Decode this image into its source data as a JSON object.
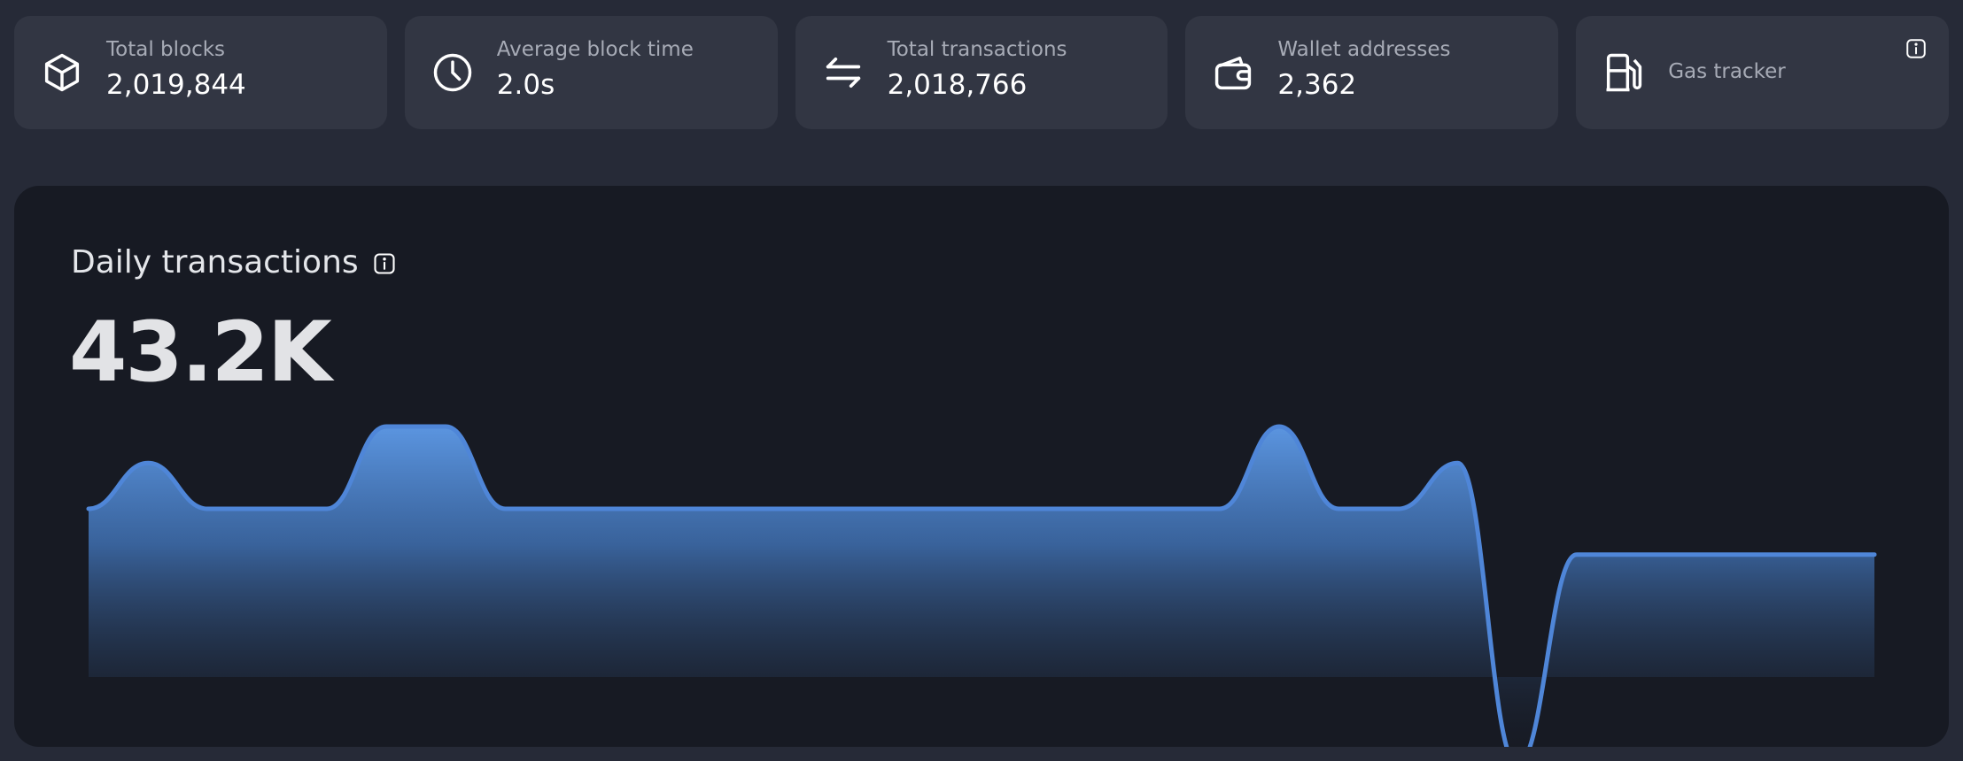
{
  "stats": {
    "total_blocks": {
      "label": "Total blocks",
      "value": "2,019,844",
      "icon": "cube-icon"
    },
    "avg_block_time": {
      "label": "Average block time",
      "value": "2.0s",
      "icon": "clock-icon"
    },
    "total_transactions": {
      "label": "Total transactions",
      "value": "2,018,766",
      "icon": "swap-arrows-icon"
    },
    "wallet_addresses": {
      "label": "Wallet addresses",
      "value": "2,362",
      "icon": "wallet-icon"
    },
    "gas_tracker": {
      "label": "Gas tracker",
      "icon": "gas-pump-icon",
      "info_icon": "info-icon"
    }
  },
  "daily_transactions": {
    "title": "Daily transactions",
    "info_icon": "info-icon",
    "value": "43.2K"
  },
  "colors": {
    "page_bg": "#262a37",
    "card_bg": "#323643",
    "chart_bg": "#171a23",
    "line": "#4f86d8"
  },
  "chart_data": {
    "type": "area",
    "x": [
      0,
      1,
      2,
      3,
      4,
      5,
      6,
      7,
      8,
      9,
      10,
      11,
      12,
      13,
      14,
      15,
      16,
      17,
      18,
      19,
      20,
      21,
      22,
      23,
      24,
      25,
      26,
      27,
      28,
      29,
      30
    ],
    "values": [
      1.9,
      2.4,
      1.9,
      1.9,
      1.9,
      2.8,
      2.8,
      1.9,
      1.9,
      1.9,
      1.9,
      1.9,
      1.9,
      1.9,
      1.9,
      1.9,
      1.9,
      1.9,
      1.9,
      1.9,
      2.8,
      1.9,
      1.9,
      2.4,
      -0.9,
      1.4,
      1.4,
      1.4,
      1.4,
      1.4,
      1.4
    ],
    "grid": false,
    "legend": "none"
  }
}
